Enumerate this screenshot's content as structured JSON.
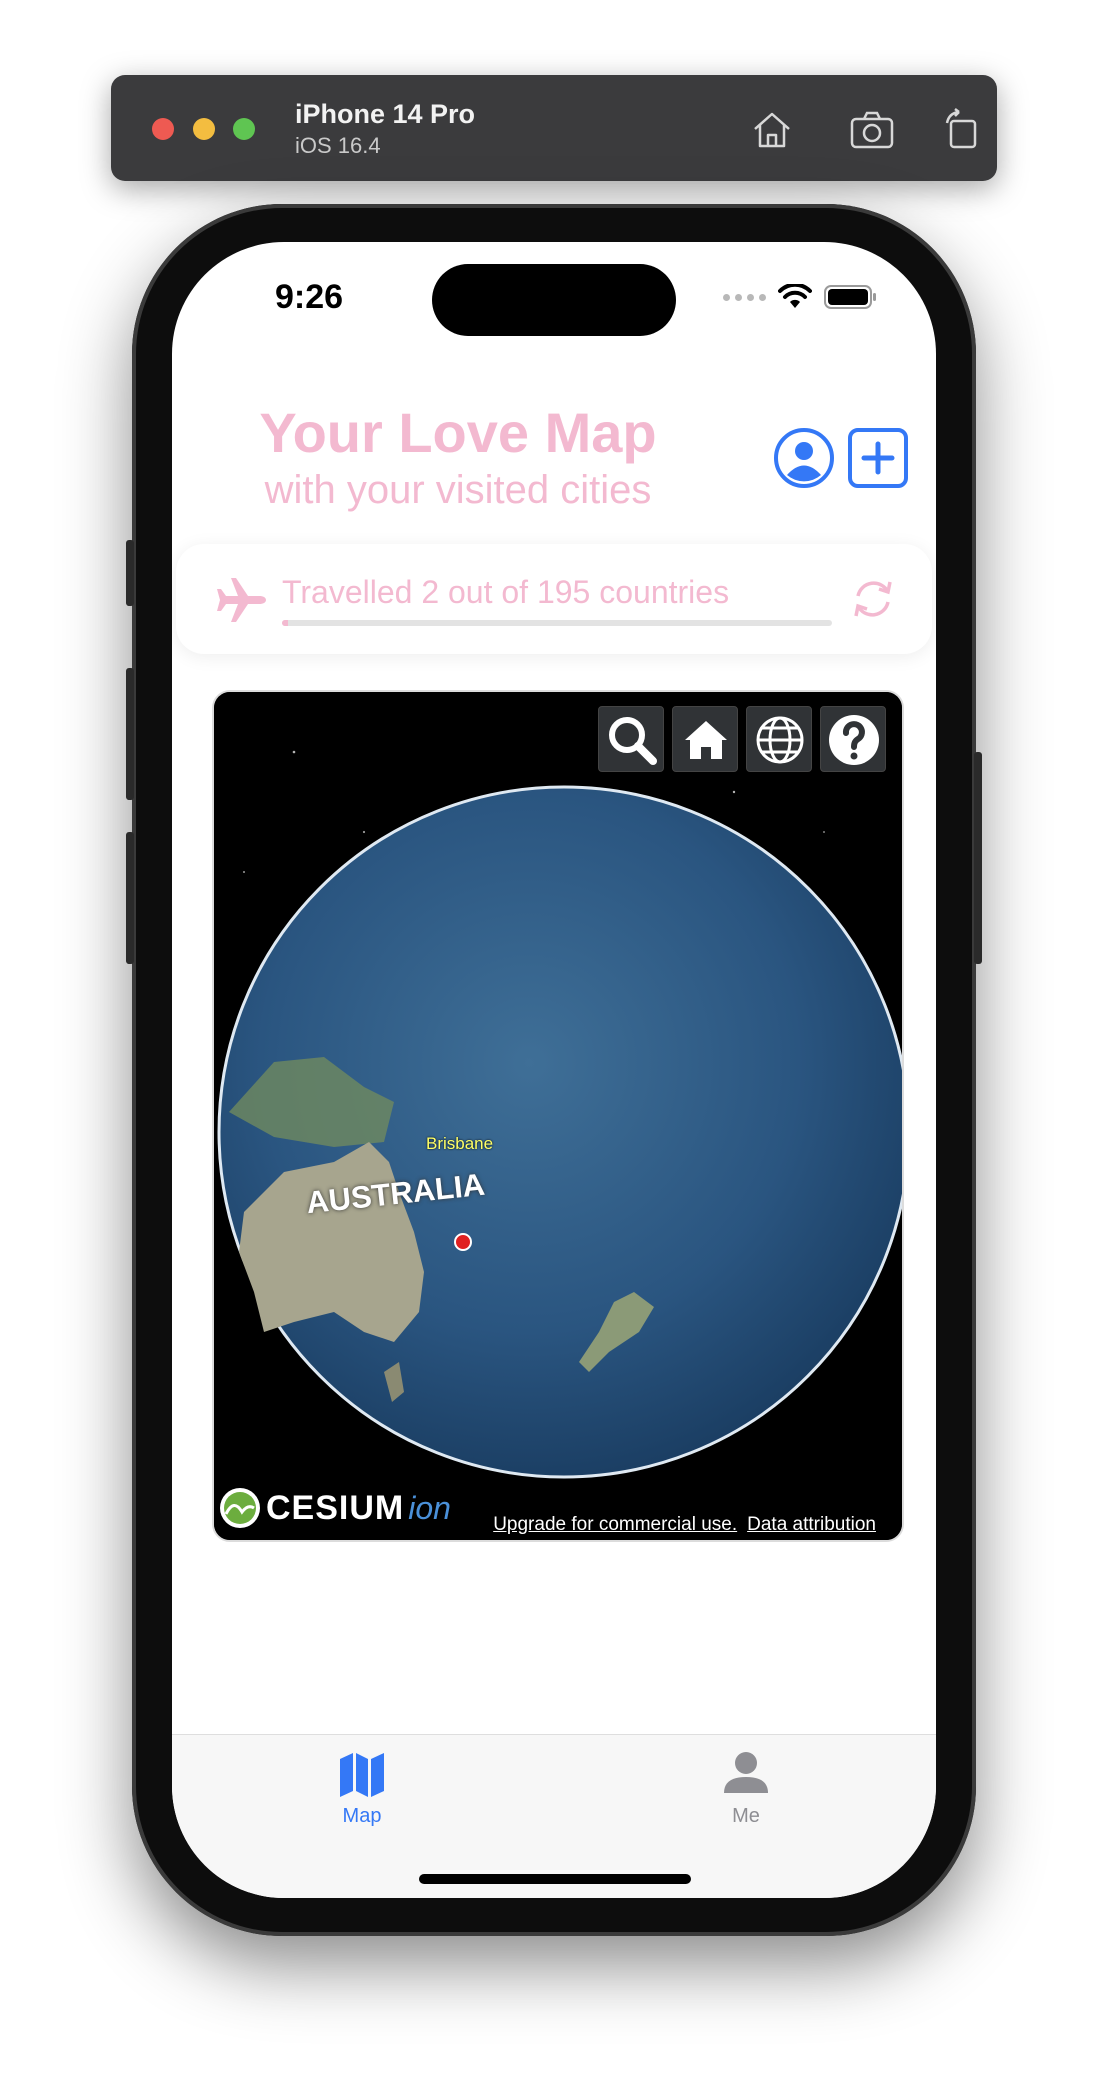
{
  "simulator": {
    "device": "iPhone 14 Pro",
    "os": "iOS 16.4",
    "buttons": [
      "home-icon",
      "screenshot-icon",
      "rotate-icon"
    ]
  },
  "status_bar": {
    "time": "9:26"
  },
  "header": {
    "title": "Your Love Map",
    "subtitle": "with your visited cities",
    "profile_icon": "person-circle-icon",
    "add_icon": "plus-square-icon"
  },
  "progress": {
    "text": "Travelled 2 out of 195 countries",
    "visited": 2,
    "total": 195,
    "fraction": 0.0103
  },
  "map": {
    "controls": [
      "search-icon",
      "home-icon",
      "globe-icon",
      "help-icon"
    ],
    "labels": {
      "city": "Brisbane",
      "country": "AUSTRALIA"
    },
    "logo_main": "CESIUM",
    "logo_suffix": "ion",
    "attribution_upgrade": "Upgrade for commercial use.",
    "attribution_data": "Data attribution"
  },
  "tabbar": {
    "tabs": [
      {
        "label": "Map",
        "active": true
      },
      {
        "label": "Me",
        "active": false
      }
    ]
  },
  "colors": {
    "accent_pink": "#f3b9d0",
    "accent_blue": "#3478f6",
    "inactive_gray": "#8e8e93",
    "marker_red": "#e02020"
  }
}
